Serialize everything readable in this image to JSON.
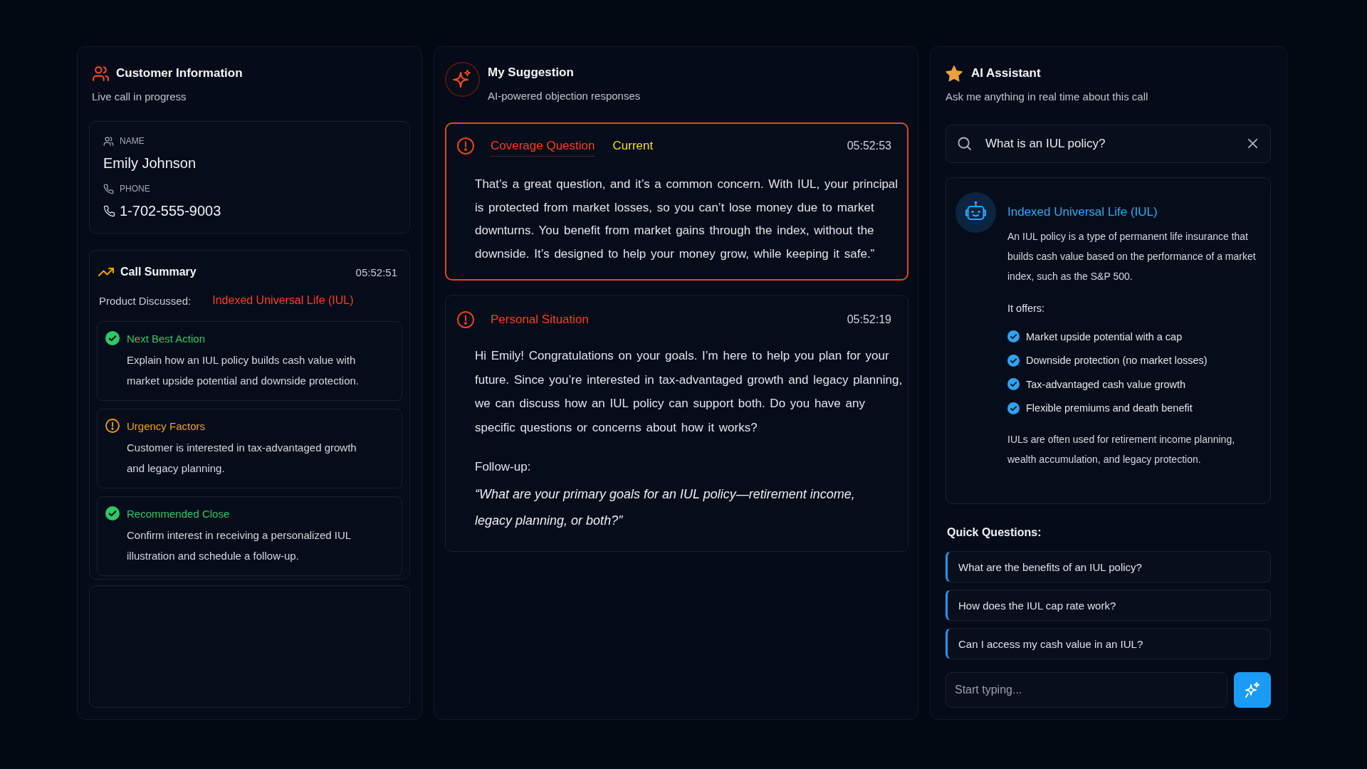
{
  "customer_panel": {
    "title": "Customer Information",
    "subtitle": "Live call in progress",
    "fields": [
      {
        "kind": "name",
        "label": "NAME",
        "value": "Emily Johnson"
      },
      {
        "kind": "phone",
        "label": "PHONE",
        "value": "1-702-555-9003"
      }
    ],
    "call_summary": {
      "title": "Call Summary",
      "time": "05:52:51",
      "product_label": "Product Discussed:",
      "product_value": "Indexed Universal Life (IUL)",
      "insights": [
        {
          "kind": "success",
          "title": "Next Best Action",
          "text": "Explain how an IUL policy builds cash value with market upside potential and downside protection."
        },
        {
          "kind": "warning",
          "title": "Urgency Factors",
          "text": "Customer is interested in tax-advantaged growth and legacy planning."
        },
        {
          "kind": "success",
          "title": "Recommended Close",
          "text": "Confirm interest in receiving a personalized IUL illustration and schedule a follow-up."
        }
      ]
    }
  },
  "suggestion_panel": {
    "title": "My Suggestion",
    "subtitle": "AI-powered objection responses",
    "suggestions": [
      {
        "category": "Coverage Question",
        "badge": "Current",
        "time": "05:52:53",
        "selected": true,
        "text": "That’s a great question, and it’s a common concern. With IUL, your principal is protected from market losses, so you can’t lose money due to market downturns. You benefit from market gains through the index, without the downside. It’s designed to help your money grow, while keeping it safe.”"
      },
      {
        "category": "Personal Situation",
        "time": "05:52:19",
        "selected": false,
        "text": "Hi Emily! Congratulations on your goals. I’m here to help you plan for your future. Since you’re interested in tax-advantaged growth and legacy planning, we can discuss how an IUL policy can support both. Do you have any specific questions or concerns about how it works?",
        "follow_up_label": "Follow-up:",
        "follow_up": "“What are your primary goals for an IUL policy—retirement income, legacy planning, or both?”"
      }
    ]
  },
  "assistant_panel": {
    "title": "AI Assistant",
    "subtitle": "Ask me anything in real time about this call",
    "search": {
      "value": "What is an IUL policy?"
    },
    "answer": {
      "title": "Indexed Universal Life (IUL)",
      "intro": "An IUL policy is a type of permanent life insurance that builds cash value based on the performance of a market index, such as the S&P 500.",
      "list_label": "It offers:",
      "points": [
        "Market upside potential with a cap",
        "Downside protection (no market losses)",
        "Tax-advantaged cash value growth",
        "Flexible premiums and death benefit"
      ],
      "outro": "IULs are often used for retirement income planning, wealth accumulation, and legacy protection."
    },
    "quick_questions_label": "Quick Questions:",
    "quick_questions": [
      "What are the benefits of an IUL policy?",
      "How does the IUL cap rate work?",
      "Can I access my cash value in an IUL?"
    ],
    "composer": {
      "placeholder": "Start typing..."
    }
  }
}
